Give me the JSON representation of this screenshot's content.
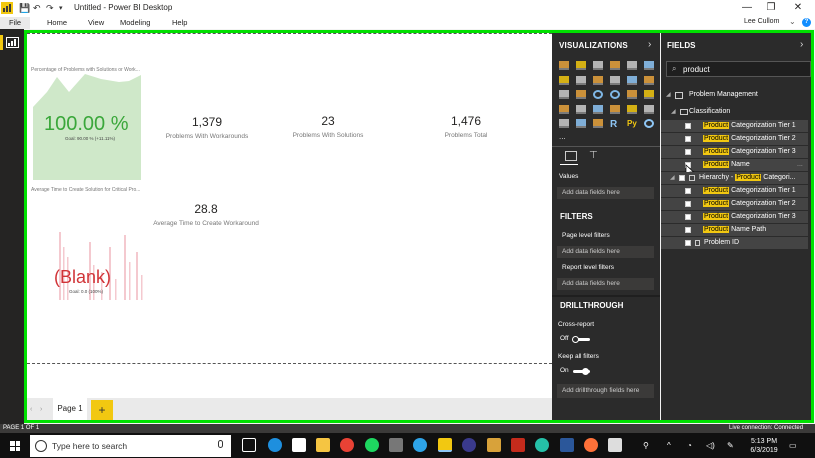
{
  "window": {
    "title": "Untitled - Power BI Desktop",
    "controls": {
      "minimize": "—",
      "restore": "❐",
      "close": "✕"
    }
  },
  "ribbon": {
    "tabs": [
      "File",
      "Home",
      "View",
      "Modeling",
      "Help"
    ],
    "user": "Lee Cullom",
    "help": "?"
  },
  "canvas": {
    "kpi_gauge": {
      "title": "Percentage of Problems with Solutions or Work...",
      "value": "100.00 %",
      "goal": "Goal: 90.00 % (+11.11%)"
    },
    "cards": [
      {
        "value": "1,379",
        "label": "Problems With Workarounds"
      },
      {
        "value": "23",
        "label": "Problems With Solutions"
      },
      {
        "value": "1,476",
        "label": "Problems Total"
      }
    ],
    "kpi_blank": {
      "title": "Average Time to Create Solution for Critical Pro...",
      "value": "(Blank)",
      "goal": "Goal: 0.0 (100%)"
    },
    "card_avg": {
      "value": "28.8",
      "label": "Average Time to Create Workaround"
    }
  },
  "pages": {
    "tab": "Page 1",
    "add": "+",
    "nav_prev": "‹",
    "nav_next": "›"
  },
  "visualizations": {
    "title": "VISUALIZATIONS",
    "more": "...",
    "values_label": "Values",
    "values_drop": "Add data fields here",
    "filters": {
      "title": "FILTERS",
      "page_level": "Page level filters",
      "page_drop": "Add data fields here",
      "report_level": "Report level filters",
      "report_drop": "Add data fields here"
    },
    "drillthrough": {
      "title": "DRILLTHROUGH",
      "cross_report": "Cross-report",
      "cross_report_state": "Off",
      "keep_filters": "Keep all filters",
      "keep_filters_state": "On",
      "drop": "Add drillthrough fields here"
    },
    "icon_labels": {
      "r": "R",
      "py": "Py"
    }
  },
  "fields": {
    "title": "FIELDS",
    "search_value": "product",
    "table": "Problem Management",
    "folder": "Classification",
    "items": [
      {
        "match": "Product",
        "rest": " Categorization Tier 1"
      },
      {
        "match": "Product",
        "rest": " Categorization Tier 2"
      },
      {
        "match": "Product",
        "rest": " Categorization Tier 3"
      },
      {
        "match": "Product",
        "rest": " Name"
      }
    ],
    "hierarchy": {
      "prefix": "Hierarchy - ",
      "match": "Product",
      "rest": " Categori..."
    },
    "hierarchy_items": [
      {
        "match": "Product",
        "rest": " Categorization Tier 1"
      },
      {
        "match": "Product",
        "rest": " Categorization Tier 2"
      },
      {
        "match": "Product",
        "rest": " Categorization Tier 3"
      },
      {
        "match": "Product",
        "rest": " Name Path"
      }
    ],
    "problem_id": "Problem ID",
    "more": "..."
  },
  "status": {
    "left": "PAGE 1 OF 1",
    "right": "Live connection: Connected"
  },
  "taskbar": {
    "search_placeholder": "Type here to search",
    "time": "5:13 PM",
    "date": "6/3/2019"
  },
  "colors": {
    "accent": "#f2c811",
    "highlight_frame": "#00e000",
    "pane_bg": "#2b2b2b"
  }
}
